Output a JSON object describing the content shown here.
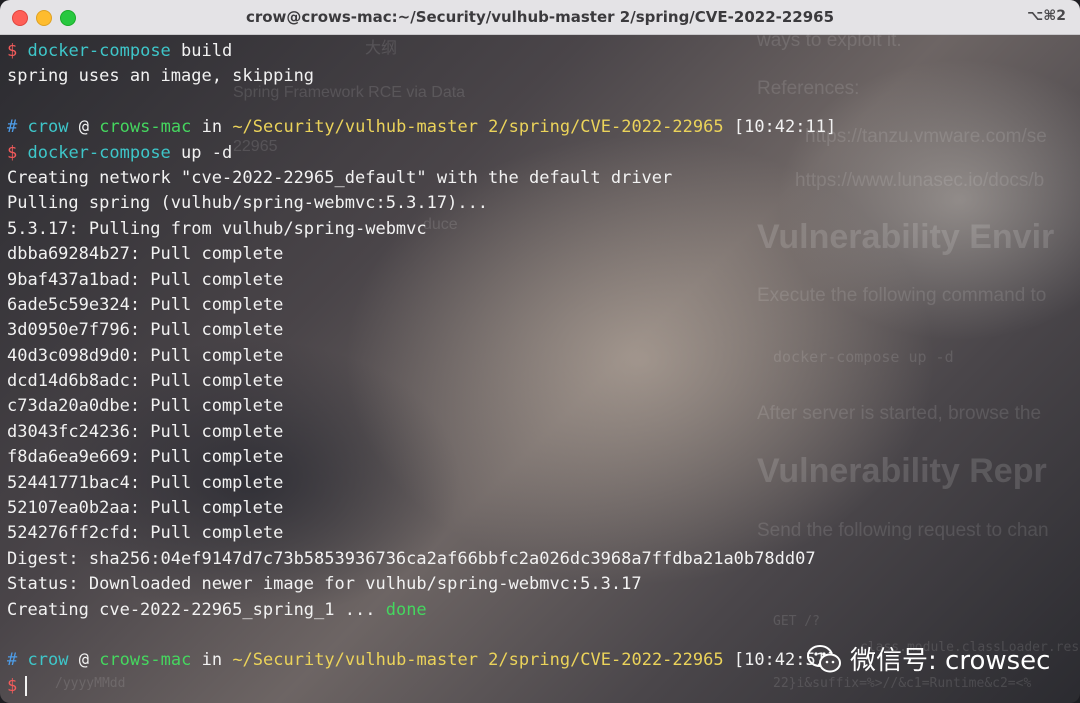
{
  "window": {
    "title": "crow@crows-mac:~/Security/vulhub-master 2/spring/CVE-2022-22965",
    "shortcut": "⌥⌘2"
  },
  "background_text": {
    "toc": "大纲",
    "item1": "Spring Framework RCE via Data",
    "item2": "22965",
    "item3": "duce",
    "intro": "ways to exploit it.",
    "references": "References:",
    "ref1": "https://tanzu.vmware.com/se",
    "ref2": "https://www.lunasec.io/docs/b",
    "h_env": "Vulnerability Envir",
    "execute": "Execute the following command to",
    "cmd": "docker-compose up -d",
    "after": "After server is started, browse the",
    "h_repro": "Vulnerability Repr",
    "send": "Send the following request to chan",
    "code1": "GET /?",
    "code2": "class.module.classLoader.rese",
    "code3": "22}i&suffix=%>//&c1=Runtime&c2=<%",
    "code4": "/yyyyMMdd"
  },
  "terminal": {
    "prompt_symbol": "$",
    "hash_symbol": "#",
    "at": "@",
    "in": "in",
    "user": "crow",
    "host": "crows-mac",
    "path": "~/Security/vulhub-master 2/spring/CVE-2022-22965",
    "cmd_build": "docker-compose",
    "cmd_build_arg": "build",
    "out_skip": "spring uses an image, skipping",
    "time1": "[10:42:11]",
    "cmd_up": "docker-compose",
    "cmd_up_arg": "up -d",
    "out_network": "Creating network \"cve-2022-22965_default\" with the default driver",
    "out_pulling": "Pulling spring (vulhub/spring-webmvc:5.3.17)...",
    "out_pullfrom": "5.3.17: Pulling from vulhub/spring-webmvc",
    "layers": [
      "dbba69284b27: Pull complete",
      "9baf437a1bad: Pull complete",
      "6ade5c59e324: Pull complete",
      "3d0950e7f796: Pull complete",
      "40d3c098d9d0: Pull complete",
      "dcd14d6b8adc: Pull complete",
      "c73da20a0dbe: Pull complete",
      "d3043fc24236: Pull complete",
      "f8da6ea9e669: Pull complete",
      "52441771bac4: Pull complete",
      "52107ea0b2aa: Pull complete",
      "524276ff2cfd: Pull complete"
    ],
    "out_digest": "Digest: sha256:04ef9147d7c73b5853936736ca2af66bbfc2a026dc3968a7ffdba21a0b78dd07",
    "out_status": "Status: Downloaded newer image for vulhub/spring-webmvc:5.3.17",
    "out_creating": "Creating cve-2022-22965_spring_1 ...",
    "out_done": "done",
    "time2": "[10:42:51]"
  },
  "watermark": {
    "text": "微信号: crowsec",
    "icon": "wechat-icon"
  }
}
